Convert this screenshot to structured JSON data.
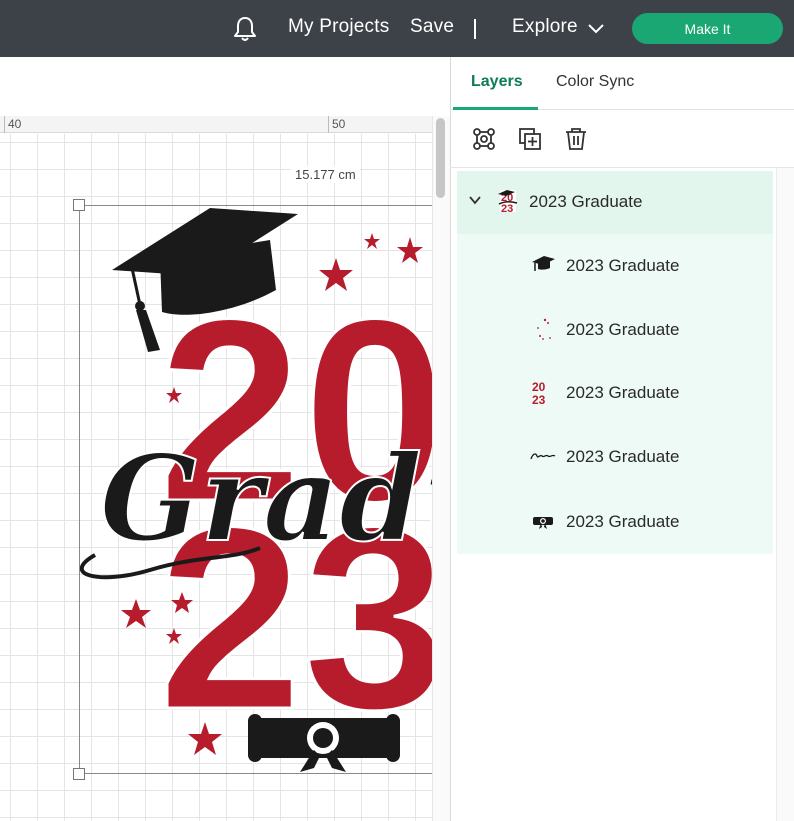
{
  "topbar": {
    "projects": "My Projects",
    "save": "Save",
    "separator": "|",
    "explore": "Explore",
    "make_it": "Make It",
    "bg": "#3d4148",
    "accent": "#1ba774"
  },
  "ruler": {
    "marks": [
      "40",
      "50"
    ]
  },
  "canvas": {
    "dimension_label": "15.177 cm"
  },
  "design": {
    "digits_top": "20",
    "digits_bottom": "23",
    "script_word": "Gradu",
    "red": "#b71c2c",
    "black": "#1a1a1a"
  },
  "panel": {
    "tabs": [
      "Layers",
      "Color Sync"
    ],
    "active_tab": "Layers",
    "tools": [
      "group-icon",
      "duplicate-icon",
      "trash-icon"
    ],
    "group_name": "2023 Graduate",
    "layers": [
      {
        "name": "2023 Graduate",
        "icon": "graduation-cap-icon"
      },
      {
        "name": "2023 Graduate",
        "icon": "stars-icon"
      },
      {
        "name": "2023 Graduate",
        "icon": "numbers-icon"
      },
      {
        "name": "2023 Graduate",
        "icon": "script-text-icon"
      },
      {
        "name": "2023 Graduate",
        "icon": "diploma-icon"
      }
    ]
  }
}
